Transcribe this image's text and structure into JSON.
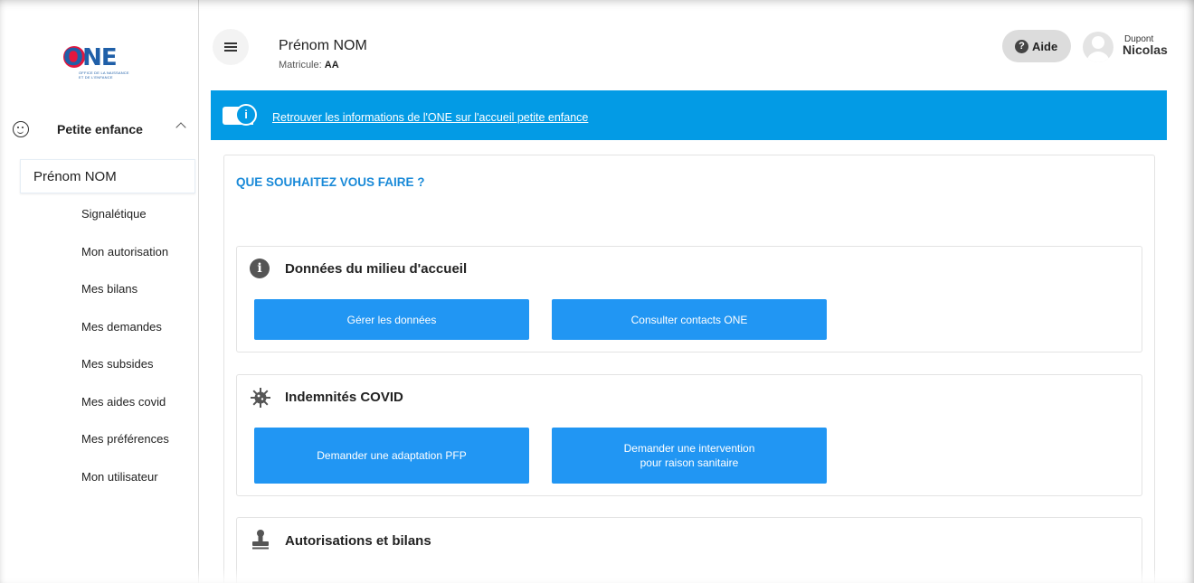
{
  "brand": {
    "logo_text": "ONE",
    "logo_subtitle": "OFFICE DE LA NAISSANCE ET DE L'ENFANCE"
  },
  "sidebar": {
    "section_label": "Petite enfance",
    "selected_item": "Prénom NOM",
    "items": [
      {
        "label": "Signalétique"
      },
      {
        "label": "Mon autorisation"
      },
      {
        "label": "Mes bilans"
      },
      {
        "label": "Mes demandes"
      },
      {
        "label": "Mes subsides"
      },
      {
        "label": "Mes aides covid"
      },
      {
        "label": "Mes préférences"
      },
      {
        "label": "Mon utilisateur"
      }
    ]
  },
  "header": {
    "user_name": "Prénom NOM",
    "matricule_label": "Matricule:",
    "matricule_value": "AA",
    "help_label": "Aide",
    "user_first_name": "Dupont",
    "user_last_name": "Nicolas"
  },
  "banner": {
    "link_text": "Retrouver les informations de l'ONE sur l'accueil petite enfance",
    "color": "#039be5"
  },
  "main": {
    "title": "QUE SOUHAITEZ VOUS FAIRE ?",
    "sections": [
      {
        "title": "Données du milieu d'accueil",
        "icon": "info-icon",
        "buttons": [
          {
            "label": "Gérer les données"
          },
          {
            "label": "Consulter contacts ONE"
          }
        ]
      },
      {
        "title": "Indemnités COVID",
        "icon": "virus-icon",
        "buttons": [
          {
            "label": "Demander une adaptation PFP"
          },
          {
            "line1": "Demander une intervention",
            "line2": "pour raison sanitaire"
          }
        ]
      },
      {
        "title": "Autorisations et bilans",
        "icon": "stamp-icon",
        "buttons": []
      }
    ]
  },
  "colors": {
    "accent": "#2196f3",
    "title_blue": "#1a8ad8",
    "logo_blue": "#1f5fa8",
    "logo_red": "#e3173e"
  }
}
